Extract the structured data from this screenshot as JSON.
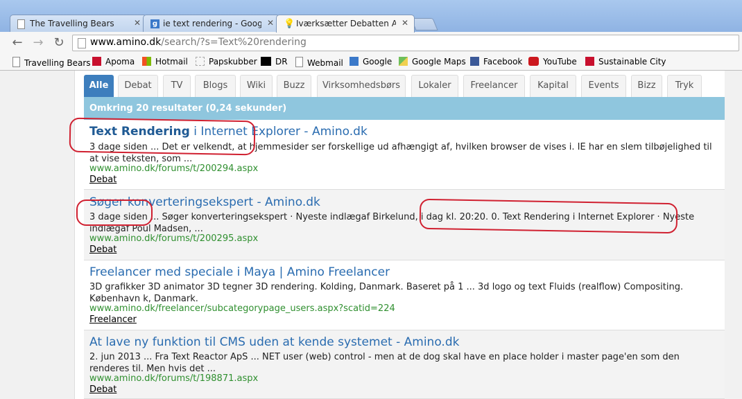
{
  "browser": {
    "tabs": [
      {
        "title": "The Travelling Bears"
      },
      {
        "title": "ie text rendering - Google"
      },
      {
        "title": "Iværksætter Debatten Amin"
      }
    ],
    "address_domain": "www.amino.dk",
    "address_path": "/search/?s=Text%20rendering"
  },
  "bookmarks": [
    {
      "label": "Travelling Bears",
      "icon": "page-icon"
    },
    {
      "label": "Apoma",
      "icon": "apoma-icon"
    },
    {
      "label": "Hotmail",
      "icon": "windows-icon"
    },
    {
      "label": "Papskubber",
      "icon": "puzzle-icon"
    },
    {
      "label": "DR",
      "icon": "dr-icon"
    },
    {
      "label": "Webmail",
      "icon": "page-icon"
    },
    {
      "label": "Google",
      "icon": "google-icon"
    },
    {
      "label": "Google Maps",
      "icon": "maps-icon"
    },
    {
      "label": "Facebook",
      "icon": "facebook-icon"
    },
    {
      "label": "YouTube",
      "icon": "youtube-icon"
    },
    {
      "label": "Sustainable City",
      "icon": "apoma-icon"
    }
  ],
  "categories": [
    "Alle",
    "Debat",
    "TV",
    "Blogs",
    "Wiki",
    "Buzz",
    "Virksomhedsbørs",
    "Lokaler",
    "Freelancer",
    "Kapital",
    "Events",
    "Bizz",
    "Tryk"
  ],
  "result_count": "Omkring 20 resultater (0,24 sekunder)",
  "results": [
    {
      "title_bold": "Text Rendering",
      "title_rest": " i Internet Explorer - Amino.dk",
      "snippet": "3 dage siden ... Det er velkendt, at hjemmesider ser forskellige ud afhængigt af, hvilken browser de vises i. IE har en slem tilbøjelighed til at vise teksten, som ...",
      "url": "www.amino.dk/forums/t/200294.aspx",
      "category": "Debat"
    },
    {
      "title_bold": "",
      "title_rest": "Søger konverteringsekspert - Amino.dk",
      "snippet": "3 dage siden ... Søger konverteringsekspert · Nyeste indlægaf Birkelund, i dag kl. 20:20. 0. Text Rendering i Internet Explorer · Nyeste indlægaf Poul Madsen, ...",
      "url": "www.amino.dk/forums/t/200295.aspx",
      "category": "Debat"
    },
    {
      "title_bold": "",
      "title_rest": "Freelancer med speciale i Maya | Amino Freelancer",
      "snippet": "3D grafikker 3D animator 3D tegner 3D rendering. Kolding, Danmark. Baseret på 1 ... 3d logo og text Fluids (realflow) Compositing. København k, Danmark.",
      "url": "www.amino.dk/freelancer/subcategorypage_users.aspx?scatid=224",
      "category": "Freelancer"
    },
    {
      "title_bold": "",
      "title_rest": "At lave ny funktion til CMS uden at kende systemet - Amino.dk",
      "snippet": "2. jun 2013 ... Fra Text Reactor ApS ... NET user (web) control - men at de dog skal have en place holder i master page'en som den renderes til. Men hvis det ...",
      "url": "www.amino.dk/forums/t/198871.aspx",
      "category": "Debat"
    }
  ],
  "colors": {
    "active_tab": "#3d7ebd",
    "result_bar": "#8fc6de",
    "link": "#2a6cb0",
    "url_green": "#2f8f2f",
    "annotation_red": "#d02030"
  }
}
